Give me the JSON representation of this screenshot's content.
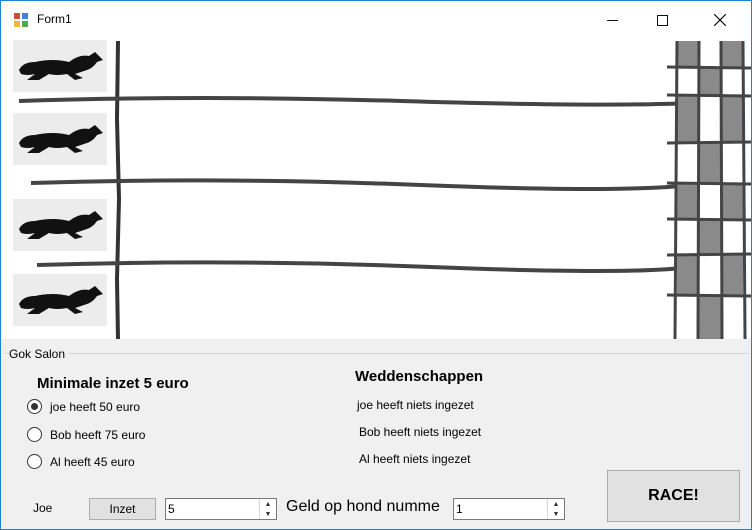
{
  "window": {
    "title": "Form1"
  },
  "titlebar": {
    "minimize": "—",
    "maximize": "☐",
    "close": "✕"
  },
  "group": {
    "label": "Gok Salon",
    "min_bet_heading": "Minimale inzet 5 euro",
    "bets_heading": "Weddenschappen",
    "bettors": [
      {
        "label": "joe heeft 50 euro",
        "checked": true
      },
      {
        "label": "Bob heeft 75 euro",
        "checked": false
      },
      {
        "label": "Al heeft 45 euro",
        "checked": false
      }
    ],
    "bets": [
      "joe heeft niets ingezet",
      "Bob heeft niets ingezet",
      "Al heeft niets ingezet"
    ],
    "selected_name": "Joe",
    "bet_button": "Inzet",
    "amount_value": "5",
    "dog_label": "Geld op hond numme",
    "dog_value": "1",
    "race_button": "RACE!"
  },
  "icons": {
    "app": "form-app-icon",
    "dogs": [
      "greyhound-icon",
      "greyhound-icon",
      "greyhound-icon",
      "greyhound-icon"
    ]
  }
}
